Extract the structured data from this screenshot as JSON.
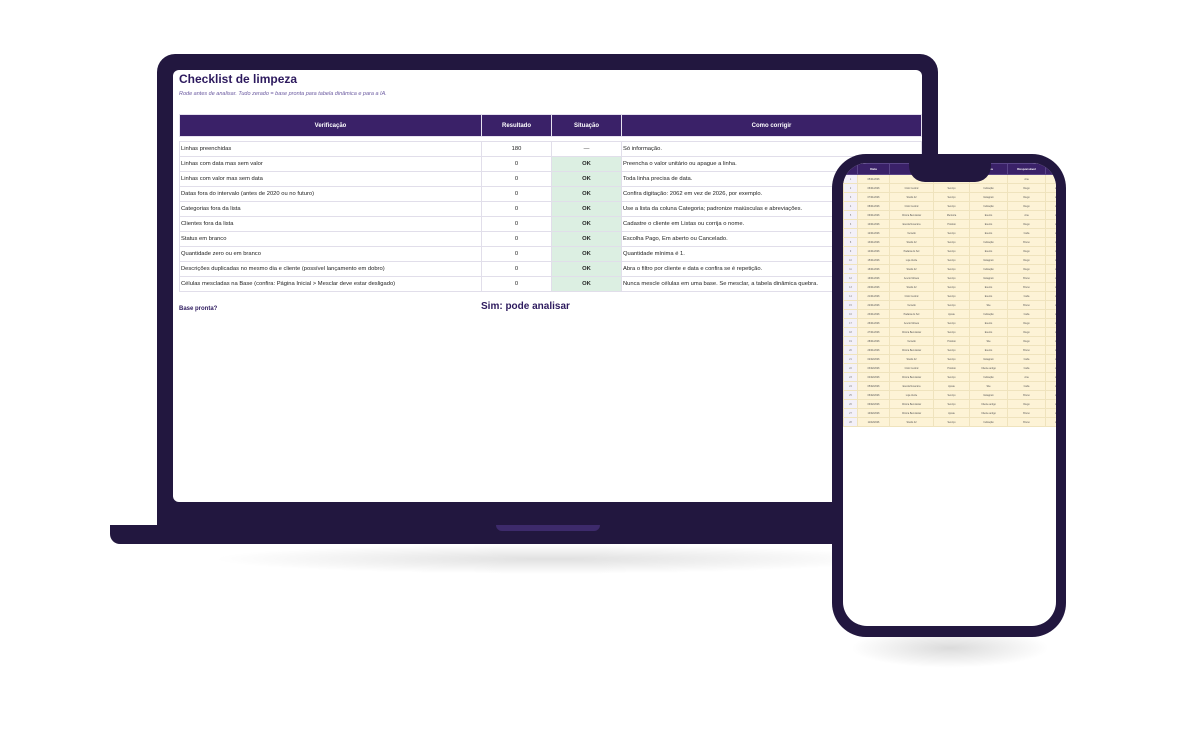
{
  "sheet": {
    "title": "Checklist de limpeza",
    "subtitle": "Rode antes de analisar. Tudo zerado = base pronta para tabela dinâmica e para a IA.",
    "columns": {
      "check": "Verificação",
      "result": "Resultado",
      "status": "Situação",
      "fix": "Como corrigir"
    },
    "rows": [
      {
        "check": "Linhas preenchidas",
        "result": "180",
        "status": "—",
        "fix": "Só informação."
      },
      {
        "check": "Linhas com data mas sem valor",
        "result": "0",
        "status": "OK",
        "fix": "Preencha o valor unitário ou apague a linha."
      },
      {
        "check": "Linhas com valor mas sem data",
        "result": "0",
        "status": "OK",
        "fix": "Toda linha precisa de data."
      },
      {
        "check": "Datas fora do intervalo (antes de 2020 ou no futuro)",
        "result": "0",
        "status": "OK",
        "fix": "Confira digitação: 2062 em vez de 2026, por exemplo."
      },
      {
        "check": "Categorias fora da lista",
        "result": "0",
        "status": "OK",
        "fix": "Use a lista da coluna Categoria; padronize maiúsculas e abreviações."
      },
      {
        "check": "Clientes fora da lista",
        "result": "0",
        "status": "OK",
        "fix": "Cadastre o cliente em Listas ou corrija o nome."
      },
      {
        "check": "Status em branco",
        "result": "0",
        "status": "OK",
        "fix": "Escolha Pago, Em aberto ou Cancelado."
      },
      {
        "check": "Quantidade zero ou em branco",
        "result": "0",
        "status": "OK",
        "fix": "Quantidade mínima é 1."
      },
      {
        "check": "Descrições duplicadas no mesmo dia e cliente (possível lançamento em dobro)",
        "result": "0",
        "status": "OK",
        "fix": "Abra o filtro por cliente e data e confira se é repetição."
      },
      {
        "check": "Células mescladas na Base (confira: Página Inicial > Mesclar deve estar desligado)",
        "result": "0",
        "status": "OK",
        "fix": "Nunca mescle células em uma base. Se mesclar, a tabela dinâmica quebra."
      }
    ],
    "ready_label": "Base pronta?",
    "ready_value": "Sim: pode analisar"
  },
  "phone": {
    "columns": [
      "",
      "Data",
      "",
      "",
      "Status",
      "Responsável",
      ""
    ],
    "rows": [
      [
        "1",
        "05/01/2026",
        "",
        "",
        "",
        "Ana",
        "L"
      ],
      [
        "2",
        "06/01/2026",
        "Ciclo Central",
        "Serviço",
        "Indicação",
        "Diego",
        "L"
      ],
      [
        "3",
        "07/01/2026",
        "Studio 42",
        "Serviço",
        "Instagram",
        "Diego",
        "L"
      ],
      [
        "4",
        "08/01/2026",
        "Ciclo Central",
        "Serviço",
        "Indicação",
        "Diego",
        "L"
      ],
      [
        "5",
        "09/01/2026",
        "Clínica Bem-Estar",
        "Mentoria",
        "Evento",
        "Ana",
        "L"
      ],
      [
        "6",
        "10/01/2026",
        "Escola Nova Era",
        "Produto",
        "Evento",
        "Diego",
        "L"
      ],
      [
        "7",
        "12/01/2026",
        "Vercello",
        "Serviço",
        "Evento",
        "Carla",
        "L"
      ],
      [
        "8",
        "13/01/2026",
        "Studio 42",
        "Serviço",
        "Indicação",
        "Bruno",
        "L"
      ],
      [
        "9",
        "14/01/2026",
        "Padaria do Sol",
        "Serviço",
        "Evento",
        "Diego",
        "L"
      ],
      [
        "10",
        "15/01/2026",
        "Loja Verde",
        "Serviço",
        "Instagram",
        "Diego",
        "L"
      ],
      [
        "11",
        "16/01/2026",
        "Studio 42",
        "Serviço",
        "Indicação",
        "Diego",
        "L"
      ],
      [
        "12",
        "19/01/2026",
        "Acerto Móveis",
        "Serviço",
        "Instagram",
        "Bruno",
        "L"
      ],
      [
        "13",
        "20/01/2026",
        "Studio 42",
        "Serviço",
        "Evento",
        "Bruno",
        "L"
      ],
      [
        "14",
        "21/01/2026",
        "Ciclo Central",
        "Serviço",
        "Evento",
        "Carla",
        "L"
      ],
      [
        "15",
        "22/01/2026",
        "Vercello",
        "Serviço",
        "Site",
        "Bruno",
        "L"
      ],
      [
        "16",
        "23/01/2026",
        "Padaria do Sol",
        "Ajuste",
        "Indicação",
        "Carla",
        "L"
      ],
      [
        "17",
        "26/01/2026",
        "Acerto Móveis",
        "Serviço",
        "Evento",
        "Diego",
        "L"
      ],
      [
        "18",
        "27/01/2026",
        "Clínica Bem-Estar",
        "Serviço",
        "Evento",
        "Diego",
        "L"
      ],
      [
        "19",
        "28/01/2026",
        "Vercello",
        "Produto",
        "Site",
        "Diego",
        "L"
      ],
      [
        "20",
        "29/01/2026",
        "Clínica Bem-Estar",
        "Serviço",
        "Evento",
        "Bruno",
        "L"
      ],
      [
        "21",
        "02/02/2026",
        "Studio 42",
        "Serviço",
        "Instagram",
        "Carla",
        "L"
      ],
      [
        "22",
        "03/02/2026",
        "Ciclo Central",
        "Produto",
        "Cliente antigo",
        "Carla",
        "L"
      ],
      [
        "23",
        "04/02/2026",
        "Clínica Bem-Estar",
        "Serviço",
        "Indicação",
        "Ana",
        "L"
      ],
      [
        "24",
        "05/02/2026",
        "Escola Nova Era",
        "Ajuste",
        "Site",
        "Carla",
        "L"
      ],
      [
        "25",
        "06/02/2026",
        "Loja Verde",
        "Serviço",
        "Instagram",
        "Bruno",
        "L"
      ],
      [
        "26",
        "09/02/2026",
        "Clínica Bem-Estar",
        "Serviço",
        "Cliente antigo",
        "Diego",
        "L"
      ],
      [
        "27",
        "10/02/2026",
        "Clínica Bem-Estar",
        "Ajuste",
        "Cliente antigo",
        "Bruno",
        "L"
      ],
      [
        "28",
        "11/02/2026",
        "Studio 42",
        "Serviço",
        "Indicação",
        "Bruno",
        "L"
      ]
    ]
  }
}
